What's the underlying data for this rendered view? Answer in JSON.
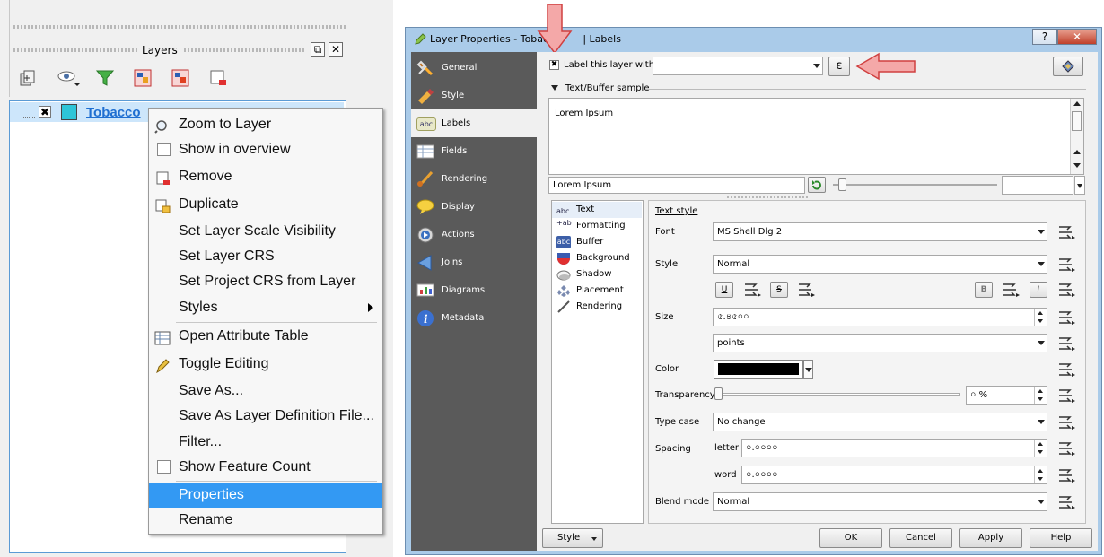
{
  "layers_panel": {
    "title": "Layers",
    "close_symbol": "✕",
    "float_symbol": "⧉",
    "layer": {
      "name": "Tobacco",
      "checked_mark": "✖",
      "color": "#2ec5d8"
    }
  },
  "context_menu": {
    "items": [
      {
        "label": "Zoom to Layer",
        "icon": "zoom-icon"
      },
      {
        "label": "Show in overview",
        "icon": "checkbox"
      },
      {
        "label": "Remove",
        "icon": "remove-layer-icon"
      },
      {
        "label": "Duplicate",
        "icon": "duplicate-icon"
      },
      {
        "label": "Set Layer Scale Visibility"
      },
      {
        "label": "Set Layer CRS"
      },
      {
        "label": "Set Project CRS from Layer"
      },
      {
        "label": "Styles",
        "submenu": true
      },
      {
        "label": "Open Attribute Table",
        "icon": "table-icon"
      },
      {
        "label": "Toggle Editing",
        "icon": "pencil-icon"
      },
      {
        "label": "Save As..."
      },
      {
        "label": "Save As Layer Definition File..."
      },
      {
        "label": "Filter..."
      },
      {
        "label": "Show Feature Count",
        "icon": "checkbox"
      },
      {
        "label": "Properties",
        "selected": true
      },
      {
        "label": "Rename"
      }
    ]
  },
  "dialog": {
    "title_left": "Layer Properties - Tobacco",
    "title_right": "| Labels",
    "help_symbol": "?",
    "close_symbol": "✕",
    "sidebar": [
      {
        "label": "General",
        "icon": "general-icon"
      },
      {
        "label": "Style",
        "icon": "style-icon"
      },
      {
        "label": "Labels",
        "icon": "labels-icon",
        "active": true,
        "badge": "abc"
      },
      {
        "label": "Fields",
        "icon": "fields-icon"
      },
      {
        "label": "Rendering",
        "icon": "rendering-icon"
      },
      {
        "label": "Display",
        "icon": "display-icon"
      },
      {
        "label": "Actions",
        "icon": "actions-icon"
      },
      {
        "label": "Joins",
        "icon": "joins-icon"
      },
      {
        "label": "Diagrams",
        "icon": "diagrams-icon"
      },
      {
        "label": "Metadata",
        "icon": "metadata-icon"
      }
    ],
    "label_this_layer": {
      "label": "Label this layer with",
      "checked_mark": "✖",
      "value": "",
      "expr_symbol": "ε"
    },
    "sample": {
      "header": "Text/Buffer sample",
      "text": "Lorem Ipsum",
      "input_value": "Lorem Ipsum",
      "preview_value": ""
    },
    "style_list": [
      {
        "label": "Text",
        "icon": "text-icon",
        "badge": "abc",
        "active": true
      },
      {
        "label": "Formatting",
        "icon": "formatting-icon",
        "badge": "+ab"
      },
      {
        "label": "Buffer",
        "icon": "buffer-icon",
        "badge": "abc"
      },
      {
        "label": "Background",
        "icon": "background-icon"
      },
      {
        "label": "Shadow",
        "icon": "shadow-icon"
      },
      {
        "label": "Placement",
        "icon": "placement-icon"
      },
      {
        "label": "Rendering",
        "icon": "rendering-icon"
      }
    ],
    "text_style": {
      "title": "Text style",
      "font_label": "Font",
      "font_value": "MS Shell Dlg 2",
      "style_label": "Style",
      "style_value": "Normal",
      "underline": "U",
      "strike": "S",
      "bold": "B",
      "italic": "I",
      "size_label": "Size",
      "size_value": "৫.৪৫০০",
      "size_unit": "points",
      "color_label": "Color",
      "color_value": "#000000",
      "transparency_label": "Transparency",
      "transparency_value": "০ %",
      "transparency_level": 0,
      "type_case_label": "Type case",
      "type_case_value": "No change",
      "spacing_label": "Spacing",
      "letter_label": "letter",
      "letter_value": "০.০০০০",
      "word_label": "word",
      "word_value": "০.০০০০",
      "blend_label": "Blend mode",
      "blend_value": "Normal"
    },
    "buttons": {
      "style": "Style",
      "ok": "OK",
      "cancel": "Cancel",
      "apply": "Apply",
      "help": "Help"
    }
  },
  "annotation_color": "#f4a8a8"
}
